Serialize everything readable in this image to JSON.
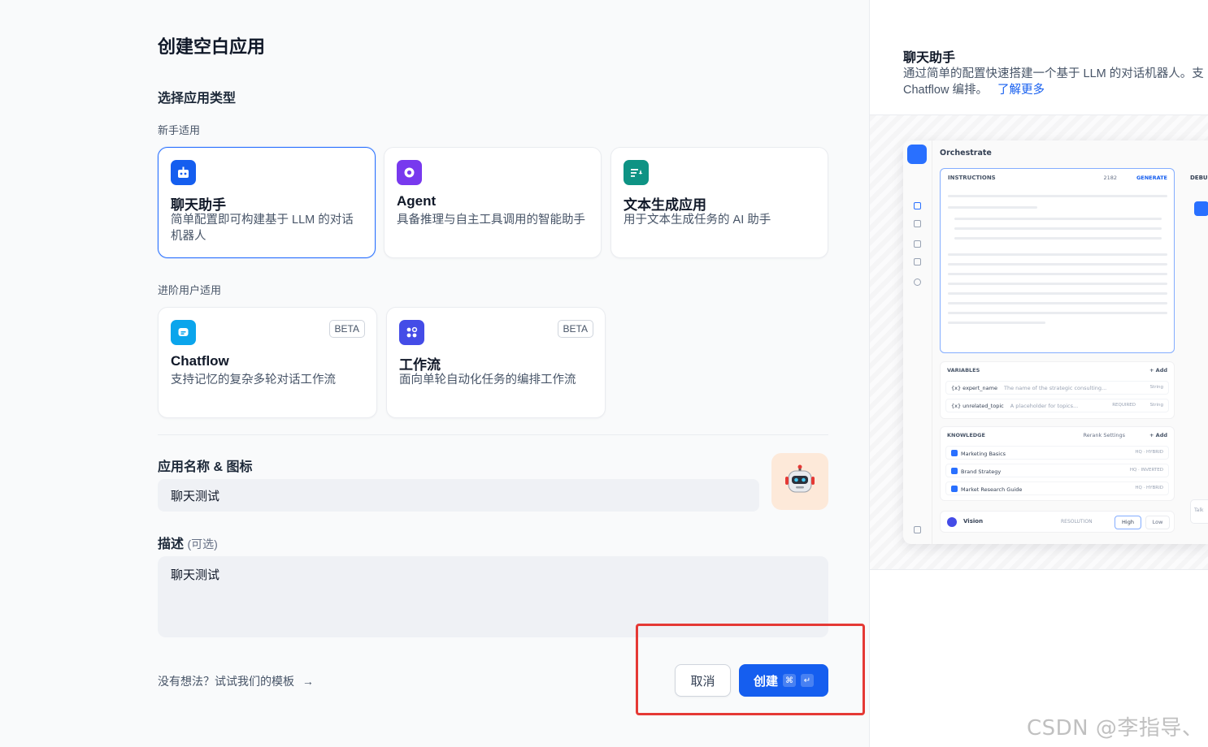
{
  "page": {
    "title": "创建空白应用",
    "select_type_title": "选择应用类型",
    "beginner_label": "新手适用",
    "advanced_label": "进阶用户适用"
  },
  "beginner_cards": [
    {
      "name": "聊天助手",
      "desc": "简单配置即可构建基于 LLM 的对话机器人",
      "icon": "chat-bot-icon",
      "color": "#155eef"
    },
    {
      "name": "Agent",
      "desc": "具备推理与自主工具调用的智能助手",
      "icon": "agent-icon",
      "color": "#7839ee"
    },
    {
      "name": "文本生成应用",
      "desc": "用于文本生成任务的 AI 助手",
      "icon": "text-generation-icon",
      "color": "#0e9384"
    }
  ],
  "advanced_cards": [
    {
      "name": "Chatflow",
      "desc": "支持记忆的复杂多轮对话工作流",
      "badge": "BETA",
      "icon": "chatflow-icon",
      "color": "#0ba5ec"
    },
    {
      "name": "工作流",
      "desc": "面向单轮自动化任务的编排工作流",
      "badge": "BETA",
      "icon": "workflow-icon",
      "color": "#444ce7"
    }
  ],
  "form": {
    "name_label": "应用名称 & 图标",
    "name_value": "聊天测试",
    "desc_label": "描述",
    "desc_optional": "(可选)",
    "desc_value": "聊天测试",
    "avatar_icon": "robot-avatar-icon"
  },
  "footer": {
    "template_link": "没有想法？试试我们的模板",
    "template_arrow": "→",
    "cancel": "取消",
    "create": "创建",
    "kbd_cmd": "⌘",
    "kbd_enter": "↵"
  },
  "side_panel": {
    "title": "聊天助手",
    "desc_line1": "通过简单的配置快速搭建一个基于 LLM 的对话机器人。支",
    "desc_line2": "Chatflow 编排。",
    "learn_more": "了解更多"
  },
  "preview": {
    "title": "Orchestrate",
    "instructions": "INSTRUCTIONS",
    "count": "2182",
    "generate": "GENERATE",
    "debug": "DEBU",
    "variables": "VARIABLES",
    "add": "+ Add",
    "var1_name": "{x} expert_name",
    "var1_desc": "The name of the strategic consulting...",
    "var1_type": "String",
    "var2_name": "{x} unrelated_topic",
    "var2_desc": "A placeholder for topics...",
    "var2_req": "REQUIRED",
    "var2_type": "String",
    "knowledge": "KNOWLEDGE",
    "rerank": "Rerank Settings",
    "kb1": "Marketing Basics",
    "kb1_tag": "HQ · HYBRID",
    "kb2": "Brand Strategy",
    "kb2_tag": "HQ · INVERTED",
    "kb3": "Market Research Guide",
    "kb3_tag": "HQ · HYBRID",
    "vision": "Vision",
    "resolution": "RESOLUTION",
    "high": "High",
    "low": "Low",
    "talk": "Talk"
  },
  "watermark": "CSDN @李指导、"
}
